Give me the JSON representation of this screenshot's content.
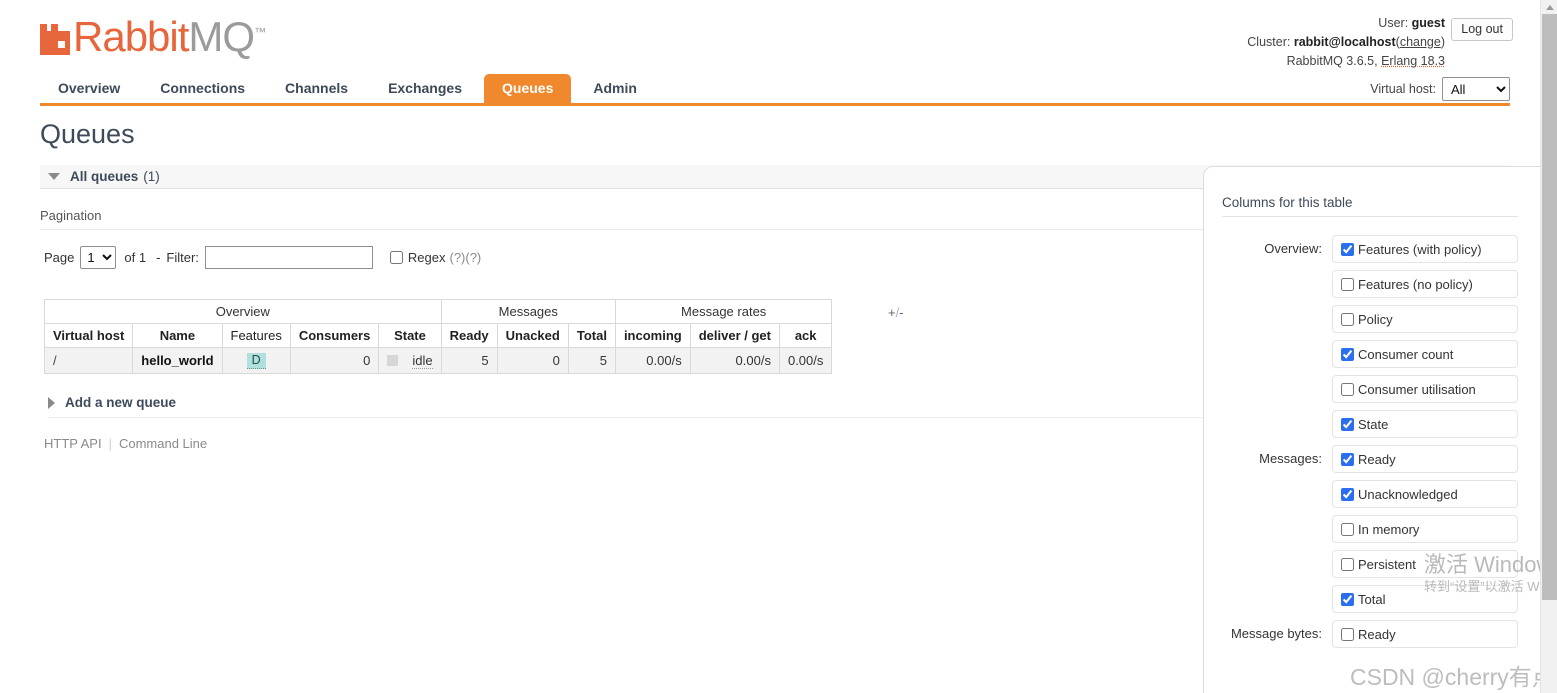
{
  "brand": {
    "name_part1": "Rabbit",
    "name_part2": "MQ",
    "tm": "™",
    "accent": "#e8663c",
    "tab_accent": "#f0882d"
  },
  "header": {
    "user_label": "User:",
    "user_value": "guest",
    "cluster_label": "Cluster:",
    "cluster_value": "rabbit@localhost",
    "cluster_change_open": "(",
    "cluster_change": "change",
    "cluster_change_close": ")",
    "version_text": "RabbitMQ 3.6.5,",
    "erlang_text": "Erlang 18.3",
    "logout_label": "Log out",
    "vhost_label": "Virtual host:",
    "vhost_selected": "All",
    "vhost_options": [
      "All"
    ]
  },
  "nav": {
    "items": [
      {
        "label": "Overview",
        "active": false
      },
      {
        "label": "Connections",
        "active": false
      },
      {
        "label": "Channels",
        "active": false
      },
      {
        "label": "Exchanges",
        "active": false
      },
      {
        "label": "Queues",
        "active": true
      },
      {
        "label": "Admin",
        "active": false
      }
    ]
  },
  "main": {
    "page_title": "Queues",
    "section_label": "All queues",
    "section_count": "(1)",
    "pagination_heading": "Pagination",
    "pagination": {
      "page_label": "Page",
      "page_selected": "1",
      "page_options": [
        "1"
      ],
      "of_label": "of 1",
      "dash": "-",
      "filter_label": "Filter:",
      "filter_value": "",
      "filter_placeholder": "",
      "regex_label": "Regex",
      "regex_checked": false,
      "hint1": "(?)",
      "hint2": "(?)"
    },
    "plus_minus": {
      "plus": "+",
      "slash": "/",
      "minus": "-"
    },
    "add_queue_label": "Add a new queue",
    "footer_links": [
      {
        "label": "HTTP API"
      },
      {
        "label": "Command Line"
      }
    ]
  },
  "table": {
    "group_headers": [
      {
        "label": "Overview",
        "span": 5
      },
      {
        "label": "Messages",
        "span": 3
      },
      {
        "label": "Message rates",
        "span": 3
      }
    ],
    "columns": [
      "Virtual host",
      "Name",
      "Features",
      "Consumers",
      "State",
      "Ready",
      "Unacked",
      "Total",
      "incoming",
      "deliver / get",
      "ack"
    ],
    "rows": [
      {
        "virtual_host": "/",
        "name": "hello_world",
        "features": "D",
        "consumers": "0",
        "state": "idle",
        "ready": "5",
        "unacked": "0",
        "total": "5",
        "incoming": "0.00/s",
        "deliver_get": "0.00/s",
        "ack": "0.00/s"
      }
    ]
  },
  "columns_panel": {
    "title": "Columns for this table",
    "groups": [
      {
        "label": "Overview:",
        "items": [
          {
            "label": "Features (with policy)",
            "checked": true
          },
          {
            "label": "Features (no policy)",
            "checked": false
          },
          {
            "label": "Policy",
            "checked": false
          },
          {
            "label": "Consumer count",
            "checked": true
          },
          {
            "label": "Consumer utilisation",
            "checked": false
          },
          {
            "label": "State",
            "checked": true
          }
        ]
      },
      {
        "label": "Messages:",
        "items": [
          {
            "label": "Ready",
            "checked": true
          },
          {
            "label": "Unacknowledged",
            "checked": true
          },
          {
            "label": "In memory",
            "checked": false
          },
          {
            "label": "Persistent",
            "checked": false
          },
          {
            "label": "Total",
            "checked": true
          }
        ]
      },
      {
        "label": "Message bytes:",
        "items": [
          {
            "label": "Ready",
            "checked": false
          }
        ]
      }
    ]
  },
  "watermarks": {
    "windows_line1": "激活 Windows",
    "windows_line2": "转到“设置”以激活 W",
    "csdn": "CSDN @cherry有点甜·"
  }
}
